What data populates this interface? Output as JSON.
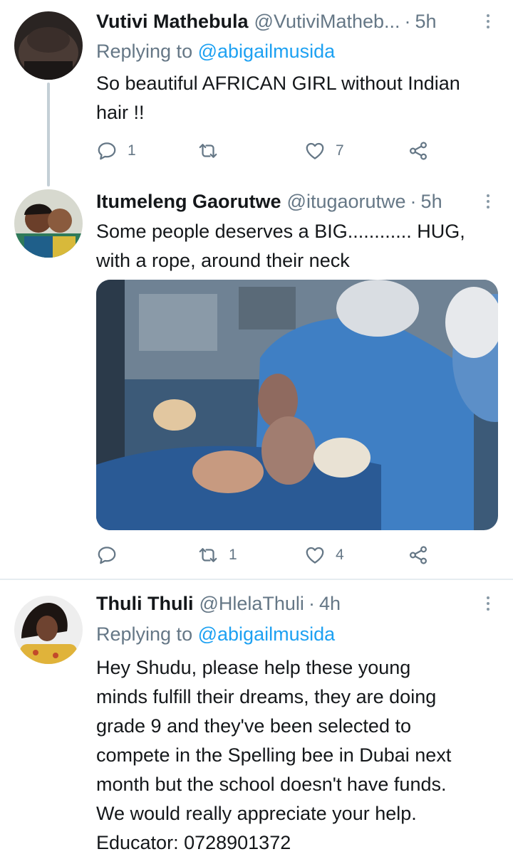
{
  "tweets": [
    {
      "name": "Vutivi Mathebula",
      "handle": "@VutiviMatheb...",
      "dot": "·",
      "time": "5h",
      "replying_prefix": "Replying to",
      "replying_to": "@abigailmusida",
      "text": "So beautiful AFRICAN GIRL without Indian\nhair !!",
      "reply_count": "1",
      "retweet_count": "",
      "like_count": "7"
    },
    {
      "name": "Itumeleng Gaorutwe",
      "handle": "@itugaorutwe",
      "dot": "·",
      "time": "5h",
      "text": "Some people deserves a BIG............ HUG,\nwith a rope, around their neck",
      "reply_count": "",
      "retweet_count": "1",
      "like_count": "4"
    },
    {
      "name": "Thuli Thuli",
      "handle": "@HlelaThuli",
      "dot": "·",
      "time": "4h",
      "replying_prefix": "Replying to",
      "replying_to": "@abigailmusida",
      "text": "Hey Shudu, please help these young\nminds fulfill their dreams, they are doing\ngrade 9 and they've been selected to\ncompete in the Spelling bee in Dubai next\nmonth but the school doesn't have funds.\nWe would really appreciate your help.\nEducator: 0728901372"
    }
  ],
  "icons": {
    "reply": "reply-icon",
    "retweet": "retweet-icon",
    "like": "heart-icon",
    "share": "share-icon",
    "more": "more-options-icon"
  },
  "colors": {
    "link": "#1da1f2",
    "secondary_text": "#657786",
    "primary_text": "#14171a",
    "thread_line": "#c4cfd6"
  }
}
